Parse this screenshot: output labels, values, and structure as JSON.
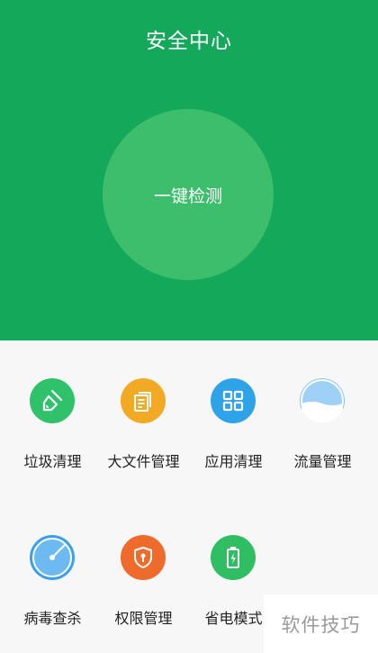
{
  "header": {
    "title": "安全中心",
    "scan_button_label": "一键检测",
    "color": "#14a85a"
  },
  "tools": [
    {
      "label": "垃圾清理",
      "icon": "broom-icon",
      "color": "#2fc26a"
    },
    {
      "label": "大文件管理",
      "icon": "documents-icon",
      "color": "#f2aa24"
    },
    {
      "label": "应用清理",
      "icon": "app-grid-icon",
      "color": "#2ea3e8"
    },
    {
      "label": "流量管理",
      "icon": "data-wave-icon",
      "color": "#7fc3f4"
    },
    {
      "label": "病毒查杀",
      "icon": "radar-icon",
      "color": "#3aa0ea"
    },
    {
      "label": "权限管理",
      "icon": "shield-lock-icon",
      "color": "#ee6b2c"
    },
    {
      "label": "省电模式",
      "icon": "battery-icon",
      "color": "#2fbf62"
    }
  ],
  "watermark": "软件技巧"
}
